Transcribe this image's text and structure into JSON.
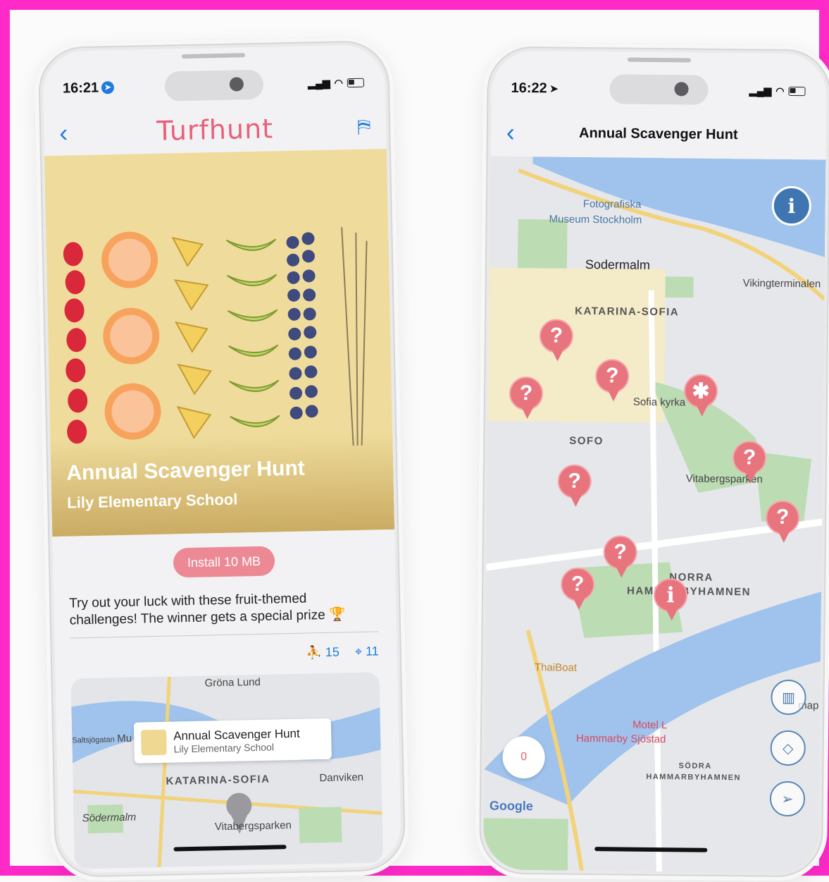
{
  "left": {
    "status": {
      "time": "16:21"
    },
    "nav": {
      "brand": "Turfhunt"
    },
    "hero": {
      "title": "Annual Scavenger Hunt",
      "subtitle": "Lily Elementary School"
    },
    "install_label": "Install 10 MB",
    "description": "Try out your luck with these fruit-themed challenges! The winner gets a special prize 🏆",
    "stats": {
      "participants": "15",
      "locations": "11"
    },
    "mini_map": {
      "callout_title": "Annual Scavenger Hunt",
      "callout_sub": "Lily Elementary School",
      "labels": [
        "Gröna Lund",
        "Mu",
        "KATARINA-SOFIA",
        "Danviken",
        "Södermalm",
        "Vitabergsparken",
        "Saltsjögatan"
      ]
    }
  },
  "right": {
    "status": {
      "time": "16:22"
    },
    "nav": {
      "title": "Annual Scavenger Hunt"
    },
    "map": {
      "labels": [
        "Fotografiska",
        "Museum Stockholm",
        "Sodermalm",
        "Vikingterminalen",
        "KATARINA-SOFIA",
        "Sofia kyrka",
        "SOFO",
        "Vitabergsparken",
        "NORRA",
        "HAMMARBYHAMNEN",
        "ThaiBoat",
        "Motel L",
        "Hammarby Sjöstad",
        "SÖDRA",
        "HAMMARBYHAMNEN",
        "Google",
        "map"
      ],
      "pin_glyph": "?",
      "zero_counter": "0"
    }
  },
  "colors": {
    "frame": "#ff2ac8",
    "accent_blue": "#1e7ce0",
    "pin_red": "#e8747e",
    "brand_pink": "#e8607a"
  },
  "icons": [
    "back-chevron-icon",
    "signpost-icon",
    "location-arrow-icon",
    "participants-icon",
    "pin-icon",
    "info-icon",
    "map-icon",
    "compass-icon",
    "navigate-icon"
  ]
}
